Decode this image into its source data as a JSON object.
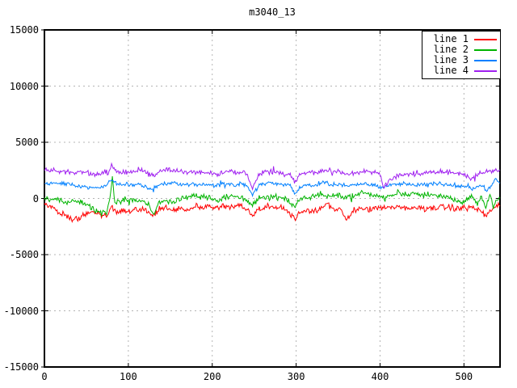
{
  "chart_data": {
    "type": "line",
    "title": "m3040_13",
    "xlabel": "",
    "ylabel": "",
    "xlim": [
      0,
      543
    ],
    "ylim": [
      -15000,
      15000
    ],
    "x_ticks": [
      0,
      100,
      200,
      300,
      400,
      500
    ],
    "y_ticks": [
      -15000,
      -10000,
      -5000,
      0,
      5000,
      10000,
      15000
    ],
    "grid": true,
    "grid_color": "#b4b4b4",
    "border_color": "#000000",
    "background": "#ffffff",
    "legend_position": "top-right",
    "series": [
      {
        "name": "line 1",
        "color": "#ff0000",
        "noise_amp": 340,
        "seed": 17,
        "keypoints": [
          [
            0,
            -500
          ],
          [
            8,
            -800
          ],
          [
            20,
            -1300
          ],
          [
            33,
            -1900
          ],
          [
            42,
            -1700
          ],
          [
            52,
            -1200
          ],
          [
            60,
            -1300
          ],
          [
            68,
            -1500
          ],
          [
            74,
            -1600
          ],
          [
            80,
            -700
          ],
          [
            86,
            -1200
          ],
          [
            95,
            -1100
          ],
          [
            105,
            -1000
          ],
          [
            118,
            -1000
          ],
          [
            128,
            -1500
          ],
          [
            136,
            -1000
          ],
          [
            148,
            -800
          ],
          [
            158,
            -900
          ],
          [
            168,
            -1000
          ],
          [
            178,
            -800
          ],
          [
            190,
            -700
          ],
          [
            202,
            -900
          ],
          [
            212,
            -700
          ],
          [
            222,
            -800
          ],
          [
            232,
            -700
          ],
          [
            240,
            -900
          ],
          [
            248,
            -1500
          ],
          [
            256,
            -900
          ],
          [
            266,
            -700
          ],
          [
            276,
            -800
          ],
          [
            288,
            -900
          ],
          [
            298,
            -1800
          ],
          [
            306,
            -1100
          ],
          [
            315,
            -1000
          ],
          [
            325,
            -1100
          ],
          [
            337,
            -500
          ],
          [
            345,
            -1100
          ],
          [
            352,
            -900
          ],
          [
            360,
            -1900
          ],
          [
            368,
            -1000
          ],
          [
            378,
            -900
          ],
          [
            390,
            -1000
          ],
          [
            400,
            -800
          ],
          [
            412,
            -900
          ],
          [
            424,
            -800
          ],
          [
            436,
            -900
          ],
          [
            448,
            -800
          ],
          [
            460,
            -900
          ],
          [
            470,
            -700
          ],
          [
            482,
            -800
          ],
          [
            494,
            -900
          ],
          [
            506,
            -800
          ],
          [
            516,
            -900
          ],
          [
            527,
            -1600
          ],
          [
            534,
            -900
          ],
          [
            543,
            -600
          ]
        ]
      },
      {
        "name": "line 2",
        "color": "#00b400",
        "noise_amp": 300,
        "seed": 29,
        "keypoints": [
          [
            0,
            -100
          ],
          [
            12,
            -100
          ],
          [
            25,
            -300
          ],
          [
            38,
            -200
          ],
          [
            50,
            -500
          ],
          [
            58,
            -900
          ],
          [
            64,
            -1300
          ],
          [
            70,
            -1000
          ],
          [
            74,
            -1400
          ],
          [
            78,
            -200
          ],
          [
            81,
            2000
          ],
          [
            84,
            -600
          ],
          [
            88,
            -300
          ],
          [
            95,
            -100
          ],
          [
            105,
            -200
          ],
          [
            115,
            -300
          ],
          [
            124,
            -500
          ],
          [
            130,
            -1600
          ],
          [
            136,
            -400
          ],
          [
            145,
            -200
          ],
          [
            152,
            -400
          ],
          [
            160,
            -100
          ],
          [
            170,
            100
          ],
          [
            180,
            200
          ],
          [
            190,
            100
          ],
          [
            200,
            0
          ],
          [
            208,
            -200
          ],
          [
            216,
            100
          ],
          [
            225,
            200
          ],
          [
            233,
            100
          ],
          [
            240,
            0
          ],
          [
            248,
            -700
          ],
          [
            255,
            0
          ],
          [
            263,
            100
          ],
          [
            272,
            200
          ],
          [
            282,
            0
          ],
          [
            290,
            -100
          ],
          [
            298,
            -900
          ],
          [
            306,
            100
          ],
          [
            314,
            0
          ],
          [
            322,
            200
          ],
          [
            330,
            400
          ],
          [
            338,
            100
          ],
          [
            348,
            300
          ],
          [
            356,
            100
          ],
          [
            365,
            200
          ],
          [
            373,
            400
          ],
          [
            382,
            500
          ],
          [
            390,
            300
          ],
          [
            398,
            200
          ],
          [
            406,
            100
          ],
          [
            415,
            300
          ],
          [
            424,
            500
          ],
          [
            432,
            300
          ],
          [
            442,
            400
          ],
          [
            452,
            300
          ],
          [
            462,
            400
          ],
          [
            472,
            200
          ],
          [
            480,
            100
          ],
          [
            488,
            -100
          ],
          [
            496,
            -400
          ],
          [
            504,
            -100
          ],
          [
            510,
            100
          ],
          [
            516,
            -600
          ],
          [
            521,
            200
          ],
          [
            526,
            -800
          ],
          [
            531,
            300
          ],
          [
            535,
            -700
          ],
          [
            539,
            -200
          ],
          [
            543,
            -100
          ]
        ]
      },
      {
        "name": "line 3",
        "color": "#0080ff",
        "noise_amp": 210,
        "seed": 41,
        "keypoints": [
          [
            0,
            1300
          ],
          [
            15,
            1400
          ],
          [
            28,
            1300
          ],
          [
            40,
            1100
          ],
          [
            52,
            1000
          ],
          [
            62,
            900
          ],
          [
            72,
            1100
          ],
          [
            80,
            1700
          ],
          [
            88,
            1200
          ],
          [
            98,
            1200
          ],
          [
            110,
            1300
          ],
          [
            120,
            1100
          ],
          [
            128,
            800
          ],
          [
            136,
            1200
          ],
          [
            146,
            1300
          ],
          [
            156,
            1400
          ],
          [
            166,
            1200
          ],
          [
            176,
            1300
          ],
          [
            186,
            1200
          ],
          [
            196,
            1300
          ],
          [
            204,
            1100
          ],
          [
            214,
            1300
          ],
          [
            224,
            1200
          ],
          [
            234,
            1300
          ],
          [
            241,
            1100
          ],
          [
            248,
            300
          ],
          [
            256,
            1200
          ],
          [
            266,
            1400
          ],
          [
            276,
            1300
          ],
          [
            286,
            1200
          ],
          [
            292,
            1300
          ],
          [
            298,
            400
          ],
          [
            306,
            1100
          ],
          [
            314,
            1200
          ],
          [
            322,
            1100
          ],
          [
            332,
            1500
          ],
          [
            342,
            1200
          ],
          [
            352,
            1300
          ],
          [
            362,
            1100
          ],
          [
            372,
            1200
          ],
          [
            382,
            1300
          ],
          [
            392,
            1200
          ],
          [
            402,
            1000
          ],
          [
            412,
            1200
          ],
          [
            422,
            1300
          ],
          [
            432,
            1300
          ],
          [
            442,
            1200
          ],
          [
            452,
            1250
          ],
          [
            462,
            1300
          ],
          [
            472,
            1300
          ],
          [
            482,
            1200
          ],
          [
            492,
            1100
          ],
          [
            502,
            1000
          ],
          [
            510,
            900
          ],
          [
            518,
            1200
          ],
          [
            524,
            1000
          ],
          [
            528,
            700
          ],
          [
            533,
            1100
          ],
          [
            537,
            1700
          ],
          [
            543,
            1400
          ]
        ]
      },
      {
        "name": "line 4",
        "color": "#a020f0",
        "noise_amp": 270,
        "seed": 53,
        "keypoints": [
          [
            0,
            2600
          ],
          [
            12,
            2500
          ],
          [
            25,
            2300
          ],
          [
            38,
            2400
          ],
          [
            50,
            2300
          ],
          [
            60,
            2100
          ],
          [
            70,
            2200
          ],
          [
            76,
            2100
          ],
          [
            80,
            2900
          ],
          [
            86,
            2400
          ],
          [
            95,
            2300
          ],
          [
            105,
            2400
          ],
          [
            115,
            2500
          ],
          [
            124,
            2300
          ],
          [
            130,
            2000
          ],
          [
            138,
            2400
          ],
          [
            148,
            2600
          ],
          [
            158,
            2500
          ],
          [
            168,
            2300
          ],
          [
            178,
            2400
          ],
          [
            188,
            2300
          ],
          [
            198,
            2200
          ],
          [
            206,
            2100
          ],
          [
            216,
            2400
          ],
          [
            226,
            2300
          ],
          [
            234,
            2400
          ],
          [
            241,
            2200
          ],
          [
            248,
            900
          ],
          [
            256,
            2200
          ],
          [
            266,
            2400
          ],
          [
            276,
            2300
          ],
          [
            286,
            2200
          ],
          [
            292,
            2300
          ],
          [
            298,
            1400
          ],
          [
            306,
            2200
          ],
          [
            314,
            2300
          ],
          [
            322,
            2200
          ],
          [
            332,
            2500
          ],
          [
            342,
            2300
          ],
          [
            352,
            2400
          ],
          [
            362,
            2200
          ],
          [
            372,
            2300
          ],
          [
            382,
            2400
          ],
          [
            392,
            2300
          ],
          [
            399,
            2200
          ],
          [
            404,
            1100
          ],
          [
            409,
            1300
          ],
          [
            416,
            1900
          ],
          [
            424,
            2100
          ],
          [
            434,
            2200
          ],
          [
            444,
            2300
          ],
          [
            454,
            2200
          ],
          [
            464,
            2300
          ],
          [
            474,
            2400
          ],
          [
            484,
            2300
          ],
          [
            494,
            2200
          ],
          [
            502,
            2100
          ],
          [
            508,
            1800
          ],
          [
            514,
            2000
          ],
          [
            522,
            2300
          ],
          [
            530,
            2400
          ],
          [
            536,
            2500
          ],
          [
            543,
            2600
          ]
        ]
      }
    ]
  }
}
